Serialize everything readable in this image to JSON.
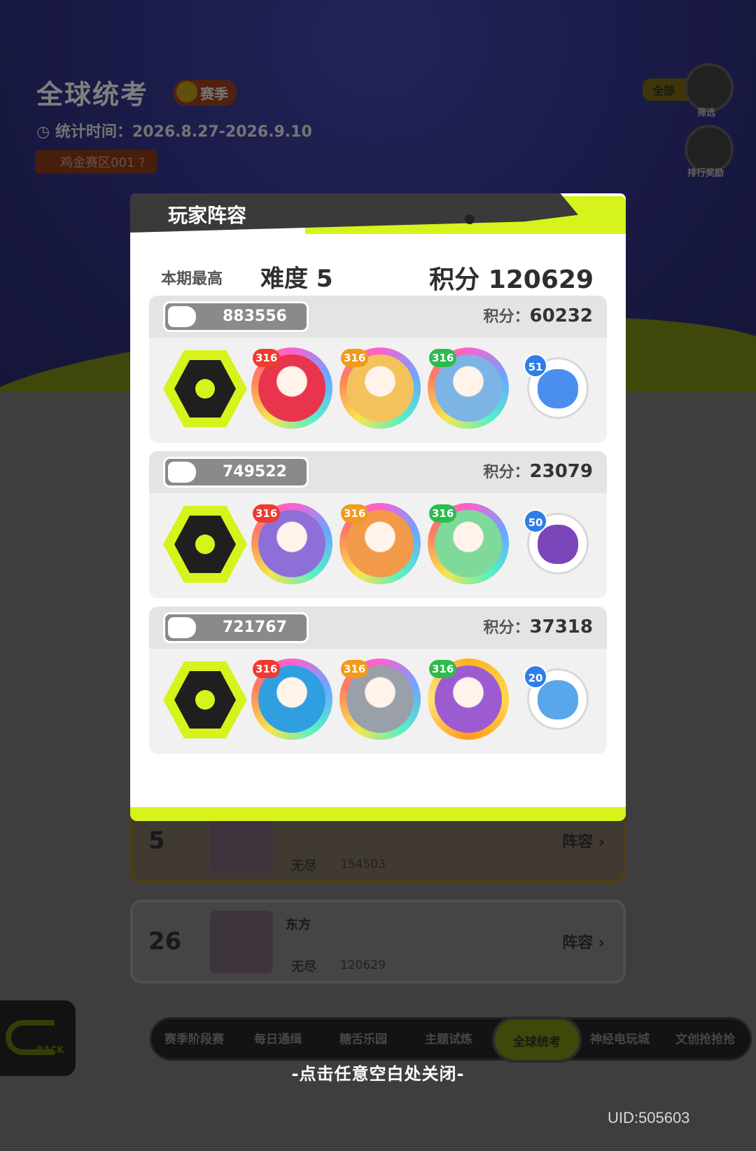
{
  "background": {
    "title": "全球统考",
    "season_badge": "赛季",
    "time_label": "统计时间：",
    "time_range": "2026.8.27-2026.9.10",
    "zone": "鸡金赛区001",
    "filter_label": "全部",
    "filter_button": "筛选",
    "rank_reward_button": "排行奖励",
    "rows": [
      {
        "rank": "5",
        "name": "",
        "mode": "无尽",
        "score": "154503",
        "lineup": "阵容"
      },
      {
        "rank": "26",
        "name": "东方",
        "mode": "无尽",
        "score": "120629",
        "lineup": "阵容"
      }
    ],
    "tabs": [
      "赛季阶段赛",
      "每日通缉",
      "糖舌乐园",
      "主题试炼",
      "全球统考",
      "神经电玩城",
      "文创抢抢抢"
    ],
    "active_tab": "全球统考",
    "back_label": "BACK"
  },
  "modal": {
    "title": "玩家阵容",
    "best_label": "本期最高",
    "best_difficulty": "难度 5",
    "best_score": "积分 120629",
    "score_label": "积分：",
    "teams": [
      {
        "id": "883556",
        "score": "60232",
        "heroes": [
          {
            "level": "316",
            "color": "#e8344c"
          },
          {
            "level": "316",
            "color": "#f4c25a"
          },
          {
            "level": "316",
            "color": "#7db4e6"
          }
        ],
        "pet": {
          "level": "51",
          "color": "#4a8ef0"
        }
      },
      {
        "id": "749522",
        "score": "23079",
        "heroes": [
          {
            "level": "316",
            "color": "#8d6fd8"
          },
          {
            "level": "316",
            "color": "#f29a4a"
          },
          {
            "level": "316",
            "color": "#7fd99a"
          }
        ],
        "pet": {
          "level": "50",
          "color": "#7a45b8"
        }
      },
      {
        "id": "721767",
        "score": "37318",
        "heroes": [
          {
            "level": "316",
            "color": "#2f9fe0"
          },
          {
            "level": "316",
            "color": "#9aa0a8"
          },
          {
            "level": "316",
            "color": "#9d5bd2",
            "gold": true
          }
        ],
        "pet": {
          "level": "20",
          "color": "#5aa6ea"
        }
      }
    ]
  },
  "close_hint": "-点击任意空白处关闭-",
  "uid": "UID:505603"
}
